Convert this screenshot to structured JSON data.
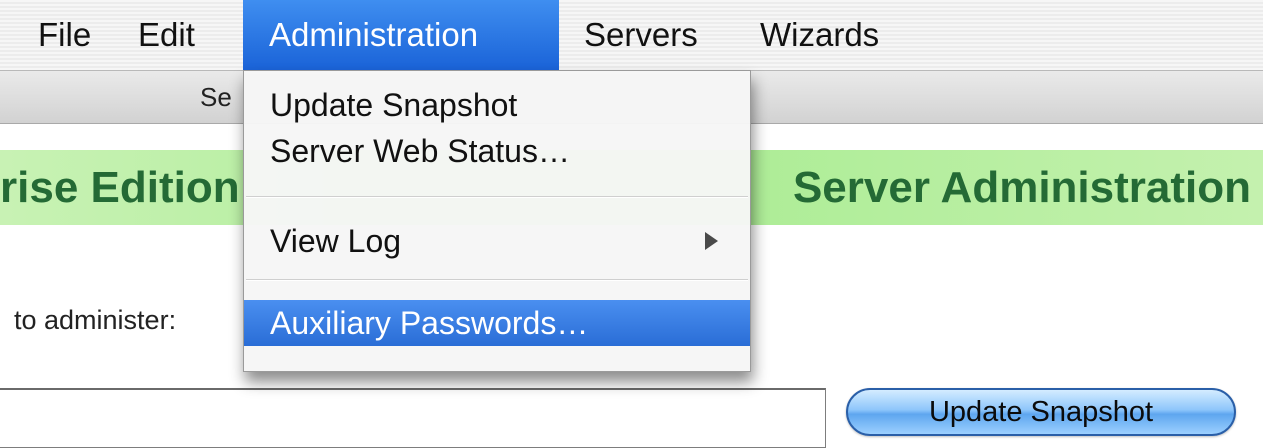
{
  "menubar": {
    "items": [
      {
        "label": "File"
      },
      {
        "label": "Edit"
      },
      {
        "label": "Administration"
      },
      {
        "label": "Servers"
      },
      {
        "label": "Wizards"
      }
    ]
  },
  "toolbar": {
    "label": "Se"
  },
  "title_band": {
    "left_text": "rise Edition",
    "right_text": "Server Administration"
  },
  "prompt": {
    "label": "to administer:"
  },
  "server_field": {
    "value": ""
  },
  "buttons": {
    "update_snapshot": "Update Snapshot"
  },
  "administration_menu": {
    "items": [
      {
        "label": "Update Snapshot"
      },
      {
        "label": "Server Web Status…"
      },
      {
        "label": "View Log"
      },
      {
        "label": "Auxiliary Passwords…"
      }
    ]
  },
  "colors": {
    "menu_highlight": "#1a63d8",
    "title_green": "#a9ec92",
    "title_text": "#246a35"
  }
}
